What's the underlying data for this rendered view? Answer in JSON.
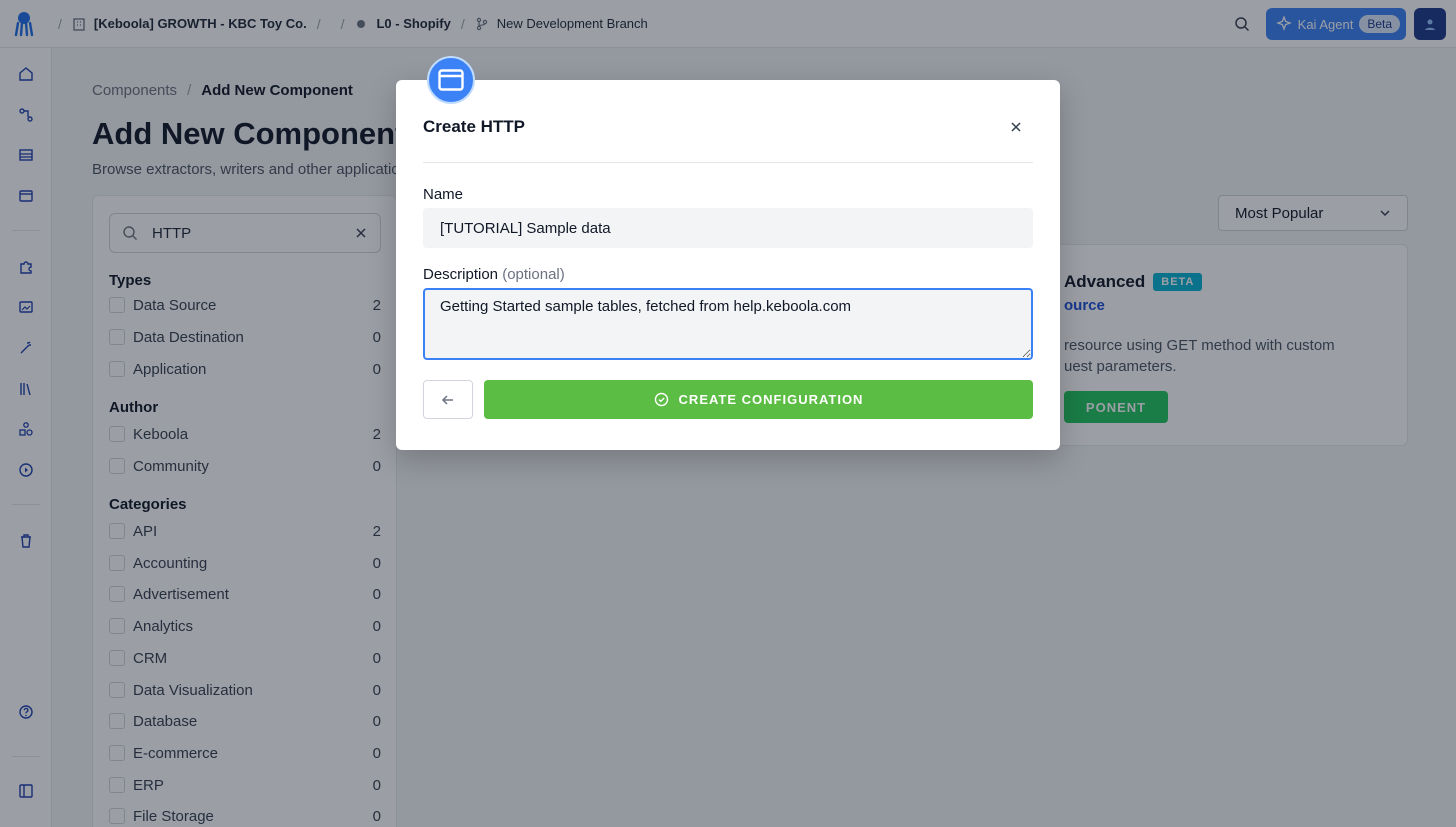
{
  "topbar": {
    "org": "[Keboola] GROWTH - KBC Toy Co.",
    "project": "L0 - Shopify",
    "branch": "New Development Branch",
    "kai_label": "Kai Agent",
    "kai_badge": "Beta"
  },
  "breadcrumb": {
    "parent": "Components",
    "separator": "/",
    "current": "Add New Component"
  },
  "page": {
    "title": "Add New Component",
    "subtitle": "Browse extractors, writers and other applications"
  },
  "filters": {
    "search_value": "HTTP",
    "types_title": "Types",
    "types": [
      {
        "label": "Data Source",
        "count": "2"
      },
      {
        "label": "Data Destination",
        "count": "0"
      },
      {
        "label": "Application",
        "count": "0"
      }
    ],
    "author_title": "Author",
    "authors": [
      {
        "label": "Keboola",
        "count": "2"
      },
      {
        "label": "Community",
        "count": "0"
      }
    ],
    "categories_title": "Categories",
    "categories": [
      {
        "label": "API",
        "count": "2"
      },
      {
        "label": "Accounting",
        "count": "0"
      },
      {
        "label": "Advertisement",
        "count": "0"
      },
      {
        "label": "Analytics",
        "count": "0"
      },
      {
        "label": "CRM",
        "count": "0"
      },
      {
        "label": "Data Visualization",
        "count": "0"
      },
      {
        "label": "Database",
        "count": "0"
      },
      {
        "label": "E-commerce",
        "count": "0"
      },
      {
        "label": "ERP",
        "count": "0"
      },
      {
        "label": "File Storage",
        "count": "0"
      }
    ]
  },
  "sort": {
    "selected": "Most Popular"
  },
  "card": {
    "title": "Advanced",
    "badge": "BETA",
    "link": "ource",
    "description": "resource using GET method with custom uest parameters.",
    "button": "PONENT"
  },
  "modal": {
    "title": "Create HTTP",
    "name_label": "Name",
    "name_value": "[TUTORIAL] Sample data",
    "description_label": "Description",
    "description_optional": "(optional)",
    "description_value": "Getting Started sample tables, fetched from help.keboola.com",
    "create_label": "CREATE CONFIGURATION"
  },
  "colors": {
    "accent": "#3b82f6",
    "create_button": "#5cbd44",
    "badge": "#06b6d4"
  }
}
